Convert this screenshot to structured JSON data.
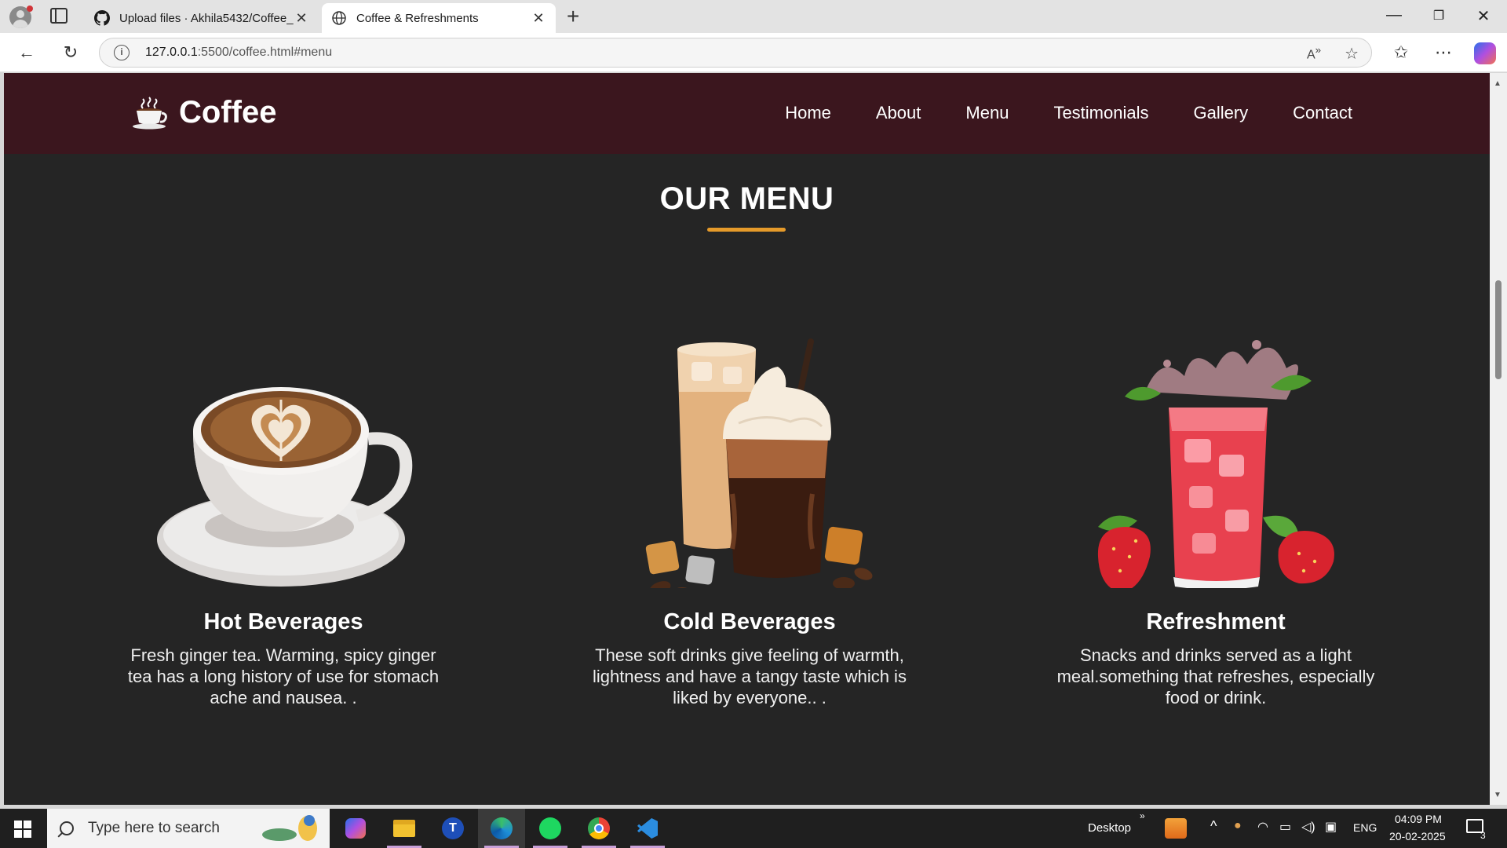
{
  "browser": {
    "tabs": [
      {
        "title": "Upload files · Akhila5432/Coffee_",
        "active": false,
        "icon": "github-icon"
      },
      {
        "title": "Coffee & Refreshments",
        "active": true,
        "icon": "globe-icon"
      }
    ],
    "url_host": "127.0.0.1",
    "url_rest": ":5500/coffee.html#menu"
  },
  "site": {
    "logo_text": "Coffee",
    "nav": [
      "Home",
      "About",
      "Menu",
      "Testimonials",
      "Gallery",
      "Contact"
    ],
    "section_title": "OUR MENU",
    "cards": [
      {
        "title": "Hot Beverages",
        "text": "Fresh ginger tea. Warming, spicy ginger tea has a long history of use for stomach ache and nausea. .",
        "image": "latte-cup-image"
      },
      {
        "title": "Cold Beverages",
        "text": "These soft drinks give feeling of warmth, lightness and have a tangy taste which is liked by everyone.. .",
        "image": "iced-coffee-image"
      },
      {
        "title": "Refreshment",
        "text": "Snacks and drinks served as a light meal.something that refreshes, especially food or drink.",
        "image": "strawberry-drink-image"
      }
    ],
    "colors": {
      "header": "#3b161e",
      "background": "#252525",
      "accent": "#e59a2a"
    }
  },
  "taskbar": {
    "search_placeholder": "Type here to search",
    "desktop_label": "Desktop",
    "language": "ENG",
    "time": "04:09 PM",
    "date": "20-02-2025",
    "notification_count": "3"
  }
}
